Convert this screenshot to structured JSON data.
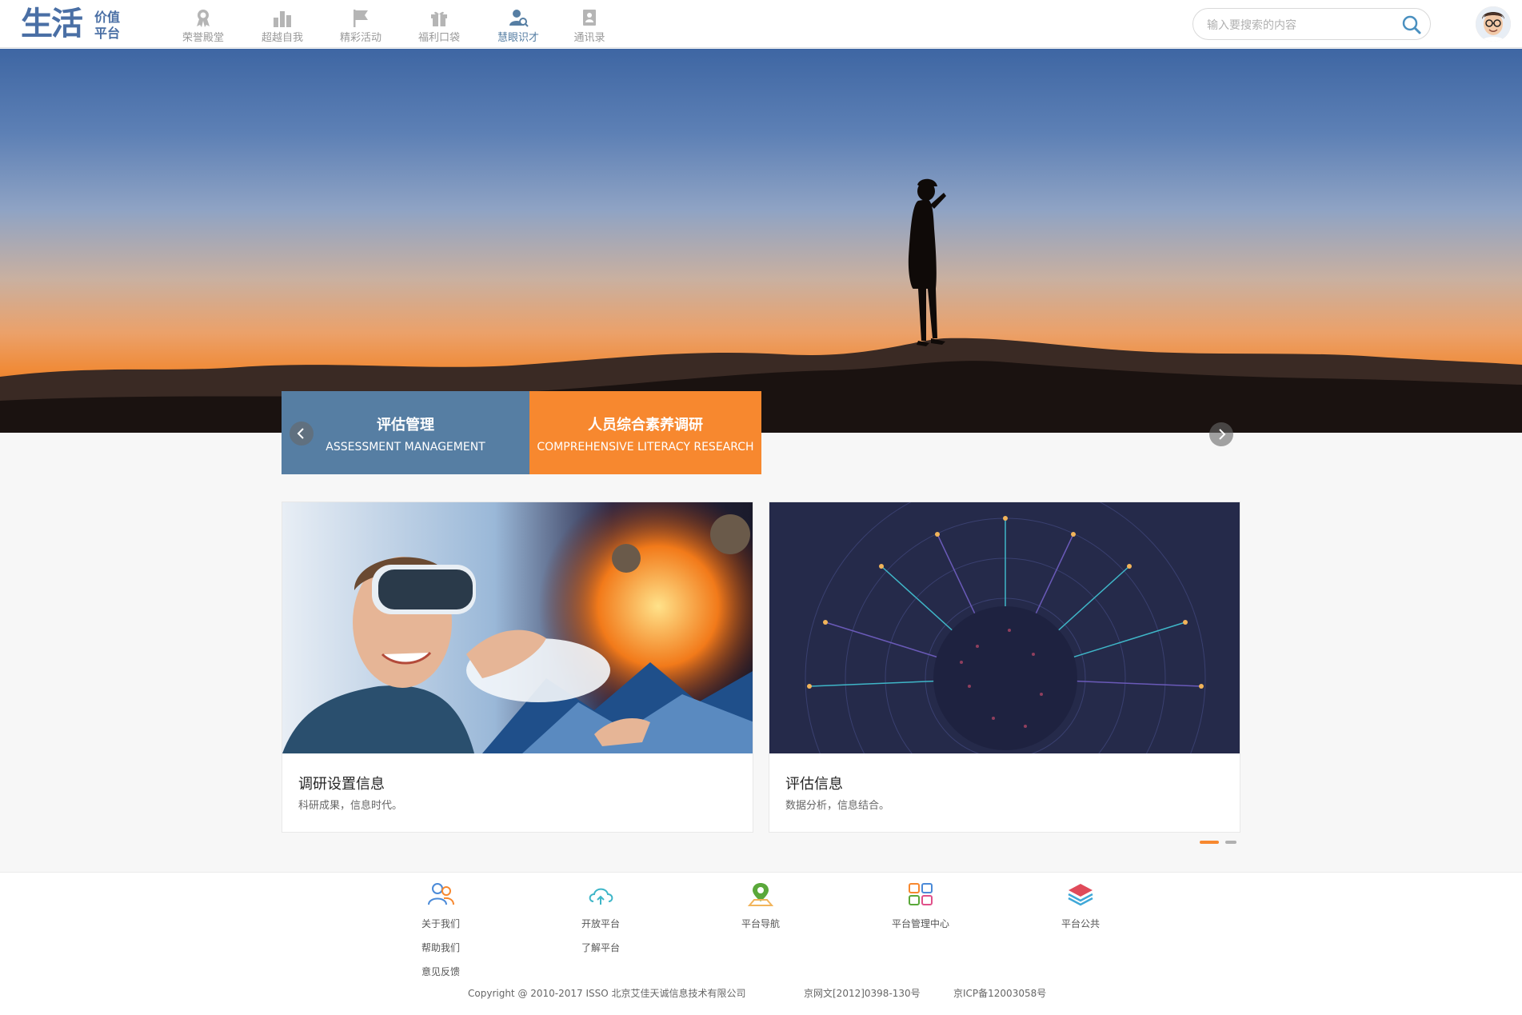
{
  "header": {
    "logo_main": "生活",
    "logo_sub_line1": "价值",
    "logo_sub_line2": "平台",
    "nav": [
      {
        "label": "荣誉殿堂",
        "icon": "medal-icon"
      },
      {
        "label": "超越自我",
        "icon": "bar-chart-icon"
      },
      {
        "label": "精彩活动",
        "icon": "flag-icon"
      },
      {
        "label": "福利口袋",
        "icon": "gift-icon"
      },
      {
        "label": "慧眼识才",
        "icon": "user-search-icon",
        "active": true
      },
      {
        "label": "通讯录",
        "icon": "contacts-icon"
      }
    ],
    "search_placeholder": "输入要搜索的内容",
    "avatar_icon": "user-avatar-icon"
  },
  "hero": {
    "tabs": [
      {
        "title": "评估管理",
        "subtitle": "ASSESSMENT MANAGEMENT",
        "color": "#567ea3"
      },
      {
        "title": "人员综合素养调研",
        "subtitle": "COMPREHENSIVE LITERACY RESEARCH",
        "color": "#f7882f"
      }
    ]
  },
  "cards": [
    {
      "title": "调研设置信息",
      "desc": "科研成果，信息时代。"
    },
    {
      "title": "评估信息",
      "desc": "数据分析，信息结合。"
    }
  ],
  "pager": {
    "active_color": "#f7882f",
    "inactive_color": "#b0b0b0"
  },
  "footer": {
    "columns": [
      {
        "icon": "users-icon",
        "links": [
          "关于我们",
          "帮助我们",
          "意见反馈"
        ]
      },
      {
        "icon": "cloud-icon",
        "links": [
          "开放平台",
          "了解平台"
        ]
      },
      {
        "icon": "map-pin-icon",
        "links": [
          "平台导航"
        ]
      },
      {
        "icon": "grid-icon",
        "links": [
          "平台管理中心"
        ]
      },
      {
        "icon": "layers-icon",
        "links": [
          "平台公共"
        ]
      }
    ],
    "copyright": "Copyright @ 2010-2017 ISSO 北京艾佳天诚信息技术有限公司",
    "license1": "京网文[2012]0398-130号",
    "license2": "京ICP备12003058号"
  }
}
